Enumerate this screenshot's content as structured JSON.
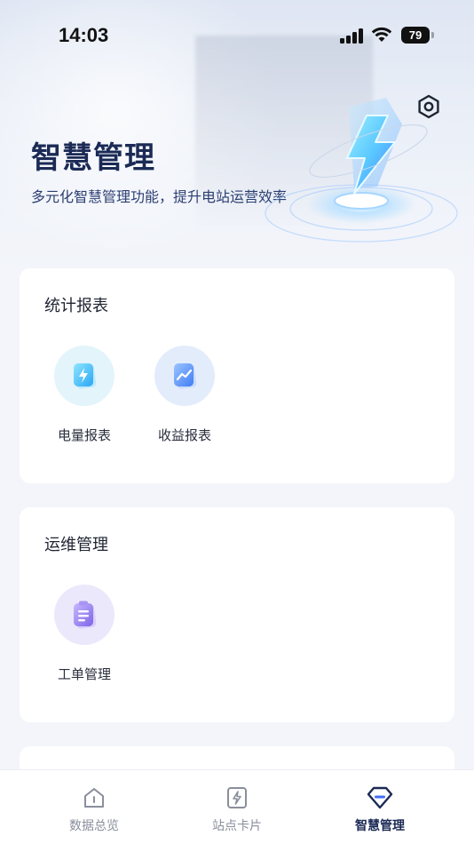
{
  "status_bar": {
    "time": "14:03",
    "battery": "79"
  },
  "header": {
    "title": "智慧管理",
    "subtitle": "多元化智慧管理功能，提升电站运营效率"
  },
  "sections": [
    {
      "title": "统计报表",
      "items": [
        {
          "label": "电量报表",
          "icon": "power-report-icon"
        },
        {
          "label": "收益报表",
          "icon": "revenue-report-icon"
        }
      ]
    },
    {
      "title": "运维管理",
      "items": [
        {
          "label": "工单管理",
          "icon": "work-order-icon"
        }
      ]
    }
  ],
  "tabbar": {
    "items": [
      {
        "label": "数据总览",
        "icon": "home-icon",
        "active": false
      },
      {
        "label": "站点卡片",
        "icon": "station-card-icon",
        "active": false
      },
      {
        "label": "智慧管理",
        "icon": "diamond-icon",
        "active": true
      }
    ]
  },
  "colors": {
    "accent": "#1b2a55",
    "tab_inactive": "#8a8f9c",
    "power_icon_bg": "#e3f4fb",
    "revenue_icon_bg": "#e3ecfb",
    "workorder_icon_bg": "#ece8fb"
  }
}
